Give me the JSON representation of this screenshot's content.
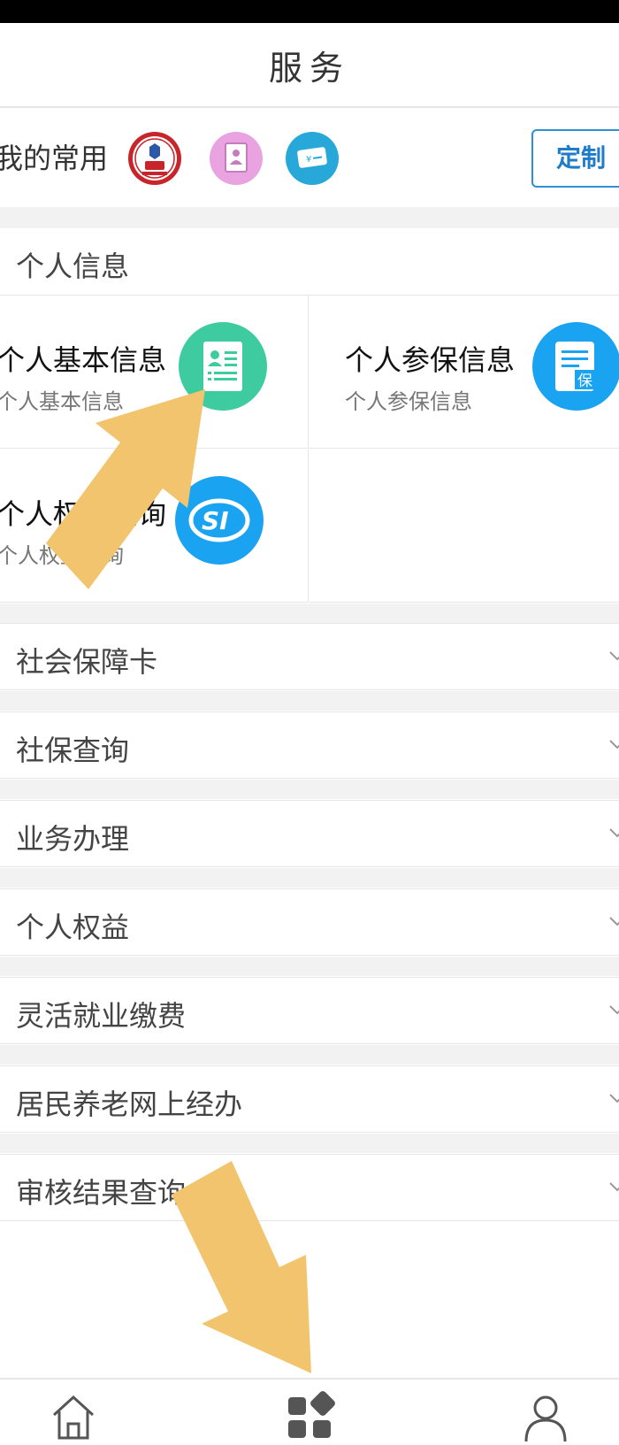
{
  "header": {
    "title": "服务"
  },
  "favorites": {
    "label": "我的常用",
    "icons": [
      "social-security-card-icon",
      "id-document-icon",
      "bank-card-icon"
    ],
    "customize_label": "定制"
  },
  "personal_info": {
    "section_title": "个人信息",
    "items": [
      {
        "title": "个人基本信息",
        "subtitle": "个人基本信息",
        "icon": "id-card-icon"
      },
      {
        "title": "个人参保信息",
        "subtitle": "个人参保信息",
        "icon": "insurance-document-icon"
      },
      {
        "title": "个人权益查询",
        "subtitle": "个人权益查询",
        "icon": "si-logo-icon"
      }
    ]
  },
  "menu": [
    {
      "label": "社会保障卡"
    },
    {
      "label": "社保查询"
    },
    {
      "label": "业务办理"
    },
    {
      "label": "个人权益"
    },
    {
      "label": "灵活就业缴费"
    },
    {
      "label": "居民养老网上经办"
    },
    {
      "label": "审核结果查询"
    }
  ],
  "colors": {
    "accent": "#1e7cc8",
    "green_icon": "#3ecba0",
    "blue_icon": "#1aa3f0",
    "arrow": "#f2c46d"
  }
}
